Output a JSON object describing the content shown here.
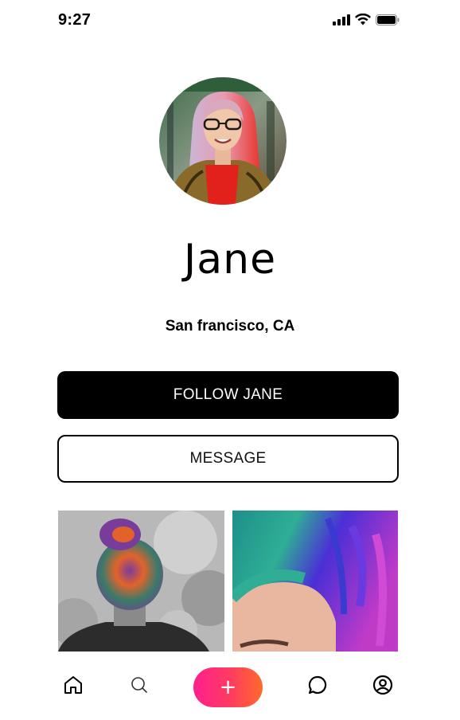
{
  "status_bar": {
    "time": "9:27",
    "icons": [
      "signal-icon",
      "wifi-icon",
      "battery-icon"
    ]
  },
  "profile": {
    "name": "Jane",
    "location": "San francisco, CA"
  },
  "actions": {
    "follow_label": "FOLLOW JANE",
    "message_label": "MESSAGE"
  },
  "nav": {
    "add_label": "+",
    "items": [
      "home-icon",
      "search-icon",
      "add-button",
      "chat-icon",
      "profile-icon"
    ]
  },
  "colors": {
    "accent_gradient": [
      "#ff1f8f",
      "#ff3d5e",
      "#ff6a2a"
    ],
    "primary_button": "#000000"
  }
}
